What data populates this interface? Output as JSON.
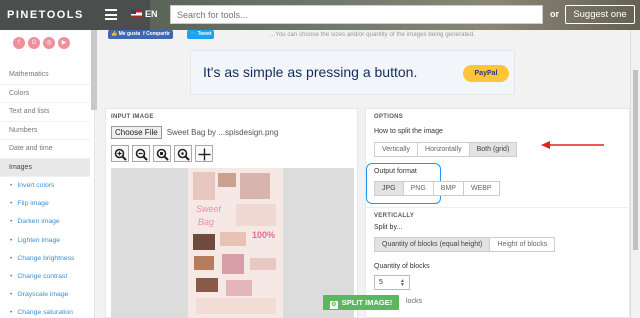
{
  "header": {
    "logo": "PINETOOLS",
    "language": "EN",
    "search_placeholder": "Search for tools...",
    "or_text": "or",
    "suggest_label": "Suggest one"
  },
  "social_icons": [
    "facebook-icon",
    "google-plus-icon",
    "instagram-icon",
    "youtube-icon"
  ],
  "sidebar": {
    "categories": [
      {
        "label": "Mathematics"
      },
      {
        "label": "Colors"
      },
      {
        "label": "Text and lists"
      },
      {
        "label": "Numbers"
      },
      {
        "label": "Date and time"
      },
      {
        "label": "Images",
        "active": true
      }
    ],
    "image_tools": [
      {
        "label": "Invert colors"
      },
      {
        "label": "Flip image"
      },
      {
        "label": "Darken image"
      },
      {
        "label": "Lighten image"
      },
      {
        "label": "Change brightness"
      },
      {
        "label": "Change contrast"
      },
      {
        "label": "Grayscale image"
      },
      {
        "label": "Change saturation"
      }
    ]
  },
  "share": {
    "like_label": "Me gusta",
    "share_label": "Compartir",
    "tweet_label": "Tweet",
    "description": "...You can choose the sizes and/or quantity of the images being generated."
  },
  "ad": {
    "text": "It's as simple as pressing a button.",
    "button_label": "PayPal"
  },
  "input_image": {
    "title": "INPUT IMAGE",
    "choose_label": "Choose File",
    "file_name": "Sweet Bag by ...spisdesign.png",
    "tool_icons": [
      "zoom-in-icon",
      "zoom-out-icon",
      "zoom-reset-icon",
      "zoom-fit-icon",
      "move-icon"
    ]
  },
  "options": {
    "title": "OPTIONS",
    "split_label": "How to split the image",
    "split_modes": [
      {
        "label": "Vertically",
        "selected": false
      },
      {
        "label": "Horizontally",
        "selected": false
      },
      {
        "label": "Both (grid)",
        "selected": true
      }
    ],
    "format_label": "Output format",
    "formats": [
      {
        "label": "JPG",
        "selected": true
      },
      {
        "label": "PNG",
        "selected": false
      },
      {
        "label": "BMP",
        "selected": false
      },
      {
        "label": "WEBP",
        "selected": false
      }
    ],
    "vertically_title": "VERTICALLY",
    "split_by_label": "Split by...",
    "split_by": [
      {
        "label": "Quantity of blocks (equal height)",
        "selected": true
      },
      {
        "label": "Height of blocks",
        "selected": false
      }
    ],
    "quantity_label": "Quantity of blocks",
    "quantity_value": "5",
    "blocks_partial": "locks"
  },
  "split_button": "SPLIT IMAGE!",
  "annotations": {
    "highlight_color": "#2196f3",
    "arrow_color": "#e02020"
  }
}
